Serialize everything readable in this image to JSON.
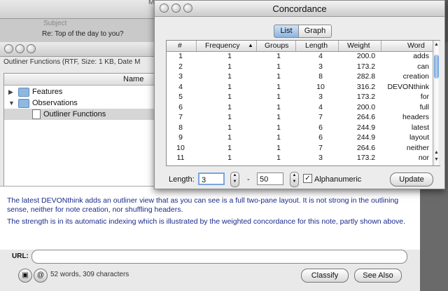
{
  "mail_window": {
    "title": "Mai",
    "subject_header": "Subject",
    "subject": "Re: Top of the day to you?"
  },
  "main_window": {
    "doc_info": "Outliner Functions (RTF, Size: 1 KB, Date M",
    "outline": {
      "column_header": "Name",
      "items": [
        {
          "label": "Features",
          "expanded": false
        },
        {
          "label": "Observations",
          "expanded": true
        },
        {
          "label": "Outliner Functions",
          "selected": true
        }
      ]
    },
    "text": {
      "para1": "The latest DEVONthink adds an outliner view that as you can see is a full two-pane layout. It is not strong in the outlining sense, neither for note creation, nor shuffling headers.",
      "para2": "The strength is in its automatic indexing which is illustrated by the weighted concordance for this note, partly shown above."
    },
    "url_label": "URL:",
    "url_value": "",
    "word_count": "52 words, 309 characters",
    "classify_label": "Classify",
    "see_also_label": "See Also",
    "lock_icon": "lock-icon",
    "at_icon": "at-icon"
  },
  "concordance": {
    "title": "Concordance",
    "tabs": [
      {
        "label": "List",
        "selected": true
      },
      {
        "label": "Graph",
        "selected": false
      }
    ],
    "columns": [
      "#",
      "Frequency",
      "Groups",
      "Length",
      "Weight",
      "Word"
    ],
    "sort_indicator": "▲",
    "rows": [
      [
        "1",
        "1",
        "1",
        "4",
        "200.0",
        "adds"
      ],
      [
        "2",
        "1",
        "1",
        "3",
        "173.2",
        "can"
      ],
      [
        "3",
        "1",
        "1",
        "8",
        "282.8",
        "creation"
      ],
      [
        "4",
        "1",
        "1",
        "10",
        "316.2",
        "DEVONthink"
      ],
      [
        "5",
        "1",
        "1",
        "3",
        "173.2",
        "for"
      ],
      [
        "6",
        "1",
        "1",
        "4",
        "200.0",
        "full"
      ],
      [
        "7",
        "1",
        "1",
        "7",
        "264.6",
        "headers"
      ],
      [
        "8",
        "1",
        "1",
        "6",
        "244.9",
        "latest"
      ],
      [
        "9",
        "1",
        "1",
        "6",
        "244.9",
        "layout"
      ],
      [
        "10",
        "1",
        "1",
        "7",
        "264.6",
        "neither"
      ],
      [
        "11",
        "1",
        "1",
        "3",
        "173.2",
        "nor"
      ]
    ],
    "length_label": "Length:",
    "length_min": "3",
    "dash": "-",
    "length_max": "50",
    "alphanumeric_label": "Alphanumeric",
    "alphanumeric_checked": "✓",
    "update_label": "Update"
  }
}
